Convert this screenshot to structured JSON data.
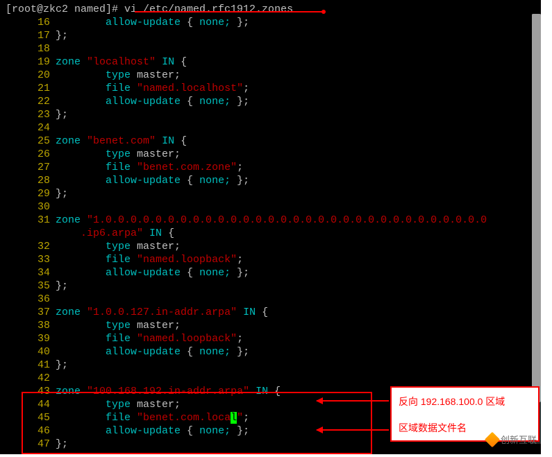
{
  "prompt": "[root@zkc2 named]# vi /etc/named.rfc1912.zones",
  "lines": [
    {
      "n": 16,
      "indent": "        ",
      "t": "allow-update { none; };",
      "type": "au"
    },
    {
      "n": 17,
      "indent": "",
      "t": "};",
      "type": "close"
    },
    {
      "n": 18,
      "indent": "",
      "t": "",
      "type": "blank"
    },
    {
      "n": 19,
      "indent": "",
      "t": "zone \"localhost\" IN {",
      "type": "zone",
      "zname": "\"localhost\""
    },
    {
      "n": 20,
      "indent": "        ",
      "t": "type master;",
      "type": "type"
    },
    {
      "n": 21,
      "indent": "        ",
      "t": "file \"named.localhost\";",
      "type": "file",
      "fname": "\"named.localhost\""
    },
    {
      "n": 22,
      "indent": "        ",
      "t": "allow-update { none; };",
      "type": "au"
    },
    {
      "n": 23,
      "indent": "",
      "t": "};",
      "type": "close"
    },
    {
      "n": 24,
      "indent": "",
      "t": "",
      "type": "blank"
    },
    {
      "n": 25,
      "indent": "",
      "t": "zone \"benet.com\" IN {",
      "type": "zone",
      "zname": "\"benet.com\""
    },
    {
      "n": 26,
      "indent": "        ",
      "t": "type master;",
      "type": "type"
    },
    {
      "n": 27,
      "indent": "        ",
      "t": "file \"benet.com.zone\";",
      "type": "file",
      "fname": "\"benet.com.zone\""
    },
    {
      "n": 28,
      "indent": "        ",
      "t": "allow-update { none; };",
      "type": "au"
    },
    {
      "n": 29,
      "indent": "",
      "t": "};",
      "type": "close"
    },
    {
      "n": 30,
      "indent": "",
      "t": "",
      "type": "blank"
    },
    {
      "n": 31,
      "indent": "",
      "t": "zone \"1.0.0.0.0.0.0.0.0.0.0.0.0.0.0.0.0.0.0.0.0.0.0.0.0.0.0.0.0.0.0.0.ip6.arpa\" IN {",
      "type": "zonewrap",
      "zname1": "\"1.0.0.0.0.0.0.0.0.0.0.0.0.0.0.0.0.0.0.0.0.0.0.0.0.0.0.0.0.0.0.0",
      "zname2": ".ip6.arpa\""
    },
    {
      "n": 32,
      "indent": "        ",
      "t": "type master;",
      "type": "type"
    },
    {
      "n": 33,
      "indent": "        ",
      "t": "file \"named.loopback\";",
      "type": "file",
      "fname": "\"named.loopback\""
    },
    {
      "n": 34,
      "indent": "        ",
      "t": "allow-update { none; };",
      "type": "au"
    },
    {
      "n": 35,
      "indent": "",
      "t": "};",
      "type": "close"
    },
    {
      "n": 36,
      "indent": "",
      "t": "",
      "type": "blank"
    },
    {
      "n": 37,
      "indent": "",
      "t": "zone \"1.0.0.127.in-addr.arpa\" IN {",
      "type": "zone",
      "zname": "\"1.0.0.127.in-addr.arpa\""
    },
    {
      "n": 38,
      "indent": "        ",
      "t": "type master;",
      "type": "type"
    },
    {
      "n": 39,
      "indent": "        ",
      "t": "file \"named.loopback\";",
      "type": "file",
      "fname": "\"named.loopback\""
    },
    {
      "n": 40,
      "indent": "        ",
      "t": "allow-update { none; };",
      "type": "au"
    },
    {
      "n": 41,
      "indent": "",
      "t": "};",
      "type": "close"
    },
    {
      "n": 42,
      "indent": "",
      "t": "",
      "type": "blank"
    },
    {
      "n": 43,
      "indent": "",
      "t": "zone \"100.168.192.in-addr.arpa\" IN {",
      "type": "zone",
      "zname": "\"100.168.192.in-addr.arpa\""
    },
    {
      "n": 44,
      "indent": "        ",
      "t": "type master;",
      "type": "type"
    },
    {
      "n": 45,
      "indent": "        ",
      "t": "file \"benet.com.local\";",
      "type": "file_cur",
      "fname_pre": "\"benet.com.loca",
      "fname_cur": "l",
      "fname_post": "\""
    },
    {
      "n": 46,
      "indent": "        ",
      "t": "allow-update { none; };",
      "type": "au"
    },
    {
      "n": 47,
      "indent": "",
      "t": "};",
      "type": "close"
    }
  ],
  "annot1": "反向 192.168.100.0 区域",
  "annot2": "区域数据文件名",
  "watermark": "创新互联"
}
